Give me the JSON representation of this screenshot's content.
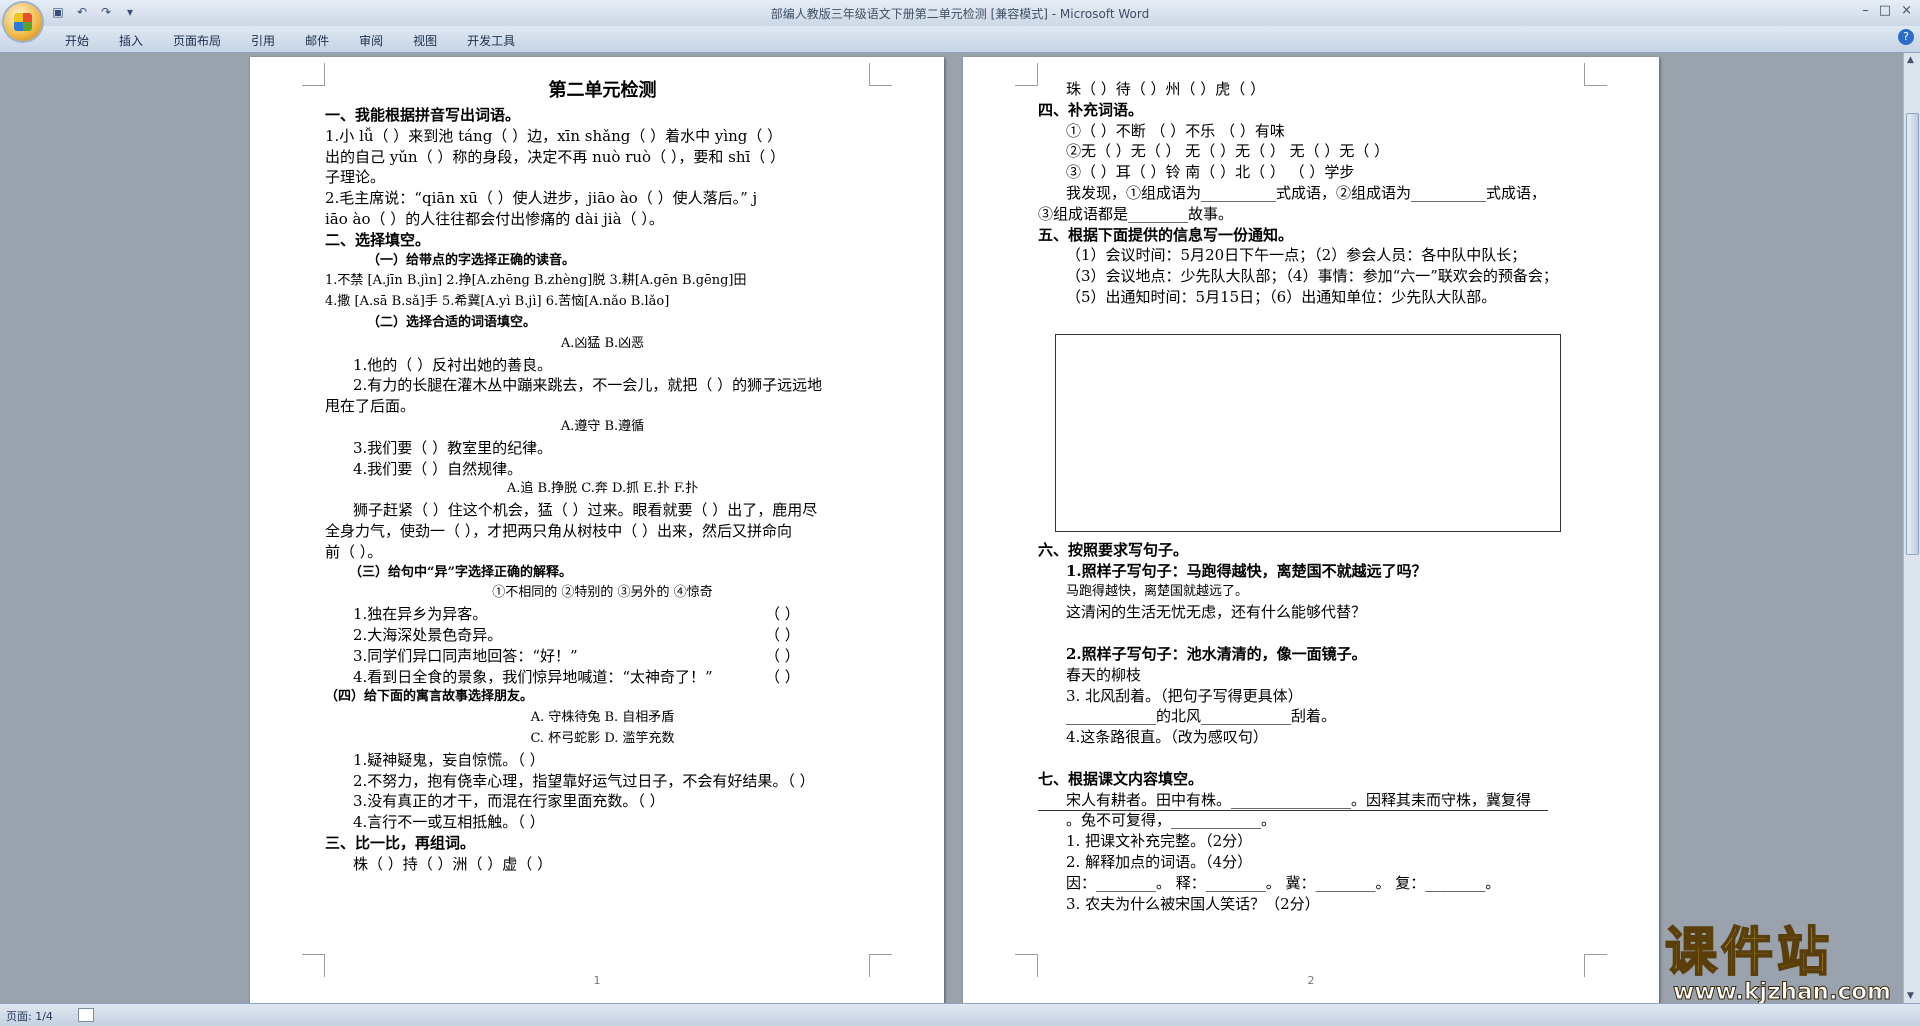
{
  "window": {
    "title": "部编人教版三年级语文下册第二单元检测 [兼容模式] - Microsoft Word",
    "controls": [
      "–",
      "□",
      "×"
    ]
  },
  "ribbon": {
    "tabs": [
      "开始",
      "插入",
      "页面布局",
      "引用",
      "邮件",
      "审阅",
      "视图",
      "开发工具"
    ],
    "help": "?"
  },
  "status": {
    "page": "页面: 1/4"
  },
  "page1": {
    "title": "第二单元检测",
    "lines": [
      "一、我能根据拼音写出词语。",
      "1.小 lǚ（   ）来到池 táng（   ）边，xīn shǎng（      ）着水中 yìng（   ）",
      "出的自己 yǔn（   ）称的身段，决定不再 nuò ruò（      ），要和 shī（   ）",
      "子理论。",
      "2.毛主席说：“qiān xū（      ）使人进步，jiāo ào（      ）使人落后。” j",
      "iāo ào（   ）的人往往都会付出惨痛的 dài jià（      ）。",
      "二、选择填空。",
      "（一）给带点的字选择正确的读音。",
      "1.不禁 [A.jīn B.jìn]    2.挣[A.zhēng B.zhèng]脱   3.耕[A.gēn B.gēng]田",
      "4.撒 [A.sā  B.sǎ]手    5.希冀[A.yì B.jì]          6.苦恼[A.nǎo B.lǎo]",
      "（二）选择合适的词语填空。",
      "A.凶猛      B.凶恶",
      "1.他的（      ）反衬出她的善良。",
      "2.有力的长腿在灌木丛中蹦来跳去，不一会儿，就把（    ）的狮子远远地",
      "甩在了后面。",
      "A.遵守      B.遵循",
      "3.我们要（    ）教室里的纪律。",
      "4.我们要（    ）自然规律。",
      "A.追      B.挣脱     C.奔     D.抓      E.扑     F.扑",
      "狮子赶紧（ ）住这个机会，猛（ ）过来。眼看就要（   ）出了，鹿用尽",
      "全身力气，使劲一（    ），才把两只角从树枝中（   ）出来，然后又拼命向",
      "前（ ）。",
      "（三）给句中“异”字选择正确的解释。",
      "①不相同的    ②特别的    ③另外的    ④惊奇",
      "1.独在异乡为异客。",
      "2.大海深处景色奇异。",
      "3.同学们异口同声地回答：“好！”",
      "4.看到日全食的景象，我们惊异地喊道：“太神奇了！”",
      "（四）给下面的寓言故事选择朋友。",
      "A. 守株待兔      B. 自相矛盾",
      "C. 杯弓蛇影      D. 滥竽充数",
      "1.疑神疑鬼，妄自惊慌。（        ）",
      "2.不努力，抱有侥幸心理，指望靠好运气过日子，不会有好结果。（        ）",
      "3.没有真正的才干，而混在行家里面充数。（        ）",
      "4.言行不一或互相抵触。（        ）",
      "三、比一比，再组词。",
      "株（         ）持（         ）洲（           ）虚（         ）"
    ],
    "answer_paren": "（        ）",
    "page_number": "1"
  },
  "page2": {
    "lines_top": [
      "珠（         ）待（         ）州（           ）虎（         ）",
      "四、补充词语。",
      "①（          ）不断      （          ）不乐         （          ）有味",
      "②无（  ）无（  ）       无（  ）无（  ）       无（  ）无（  ）",
      "③（  ）耳（  ）铃       南（  ）北（  ）       （          ）学步",
      "我发现，①组成语为__________式成语，②组成语为__________式成语，",
      "③组成语都是________故事。",
      "五、根据下面提供的信息写一份通知。",
      "（1）会议时间：5月20日下午一点；（2）参会人员：各中队中队长；",
      "（3）会议地点：少先队大队部；（4）事情：参加“六一”联欢会的预备会；",
      "（5）出通知时间：5月15日；（6）出通知单位：少先队大队部。"
    ],
    "lines_bottom": [
      "六、按照要求写句子。",
      "1.照样子写句子：马跑得越快，离楚国不就越远了吗？",
      "马跑得越快，离楚国就越远了。",
      "这清闲的生活无忧无虑，还有什么能够代替？",
      "",
      "2.照样子写句子：池水清清的，像一面镜子。",
      "春天的柳枝",
      "3. 北风刮着。（把句子写得更具体）",
      "____________的北风____________刮着。",
      "4.这条路很直。（改为感叹句）",
      "",
      "七、根据课文内容填空。",
      "宋人有耕者。田中有株。________________。因释其耒而守株，冀复得",
      "。兔不可复得，____________。",
      "1. 把课文补充完整。（2分）",
      "2. 解释加点的词语。（4分）",
      "因：________。  释：________。  冀：________。  复：________。",
      "3. 农夫为什么被宋国人笑话？（2分）"
    ],
    "page_number": "2"
  },
  "watermark": {
    "logo_text": "课件站",
    "url": "www.kjzhan.com"
  }
}
